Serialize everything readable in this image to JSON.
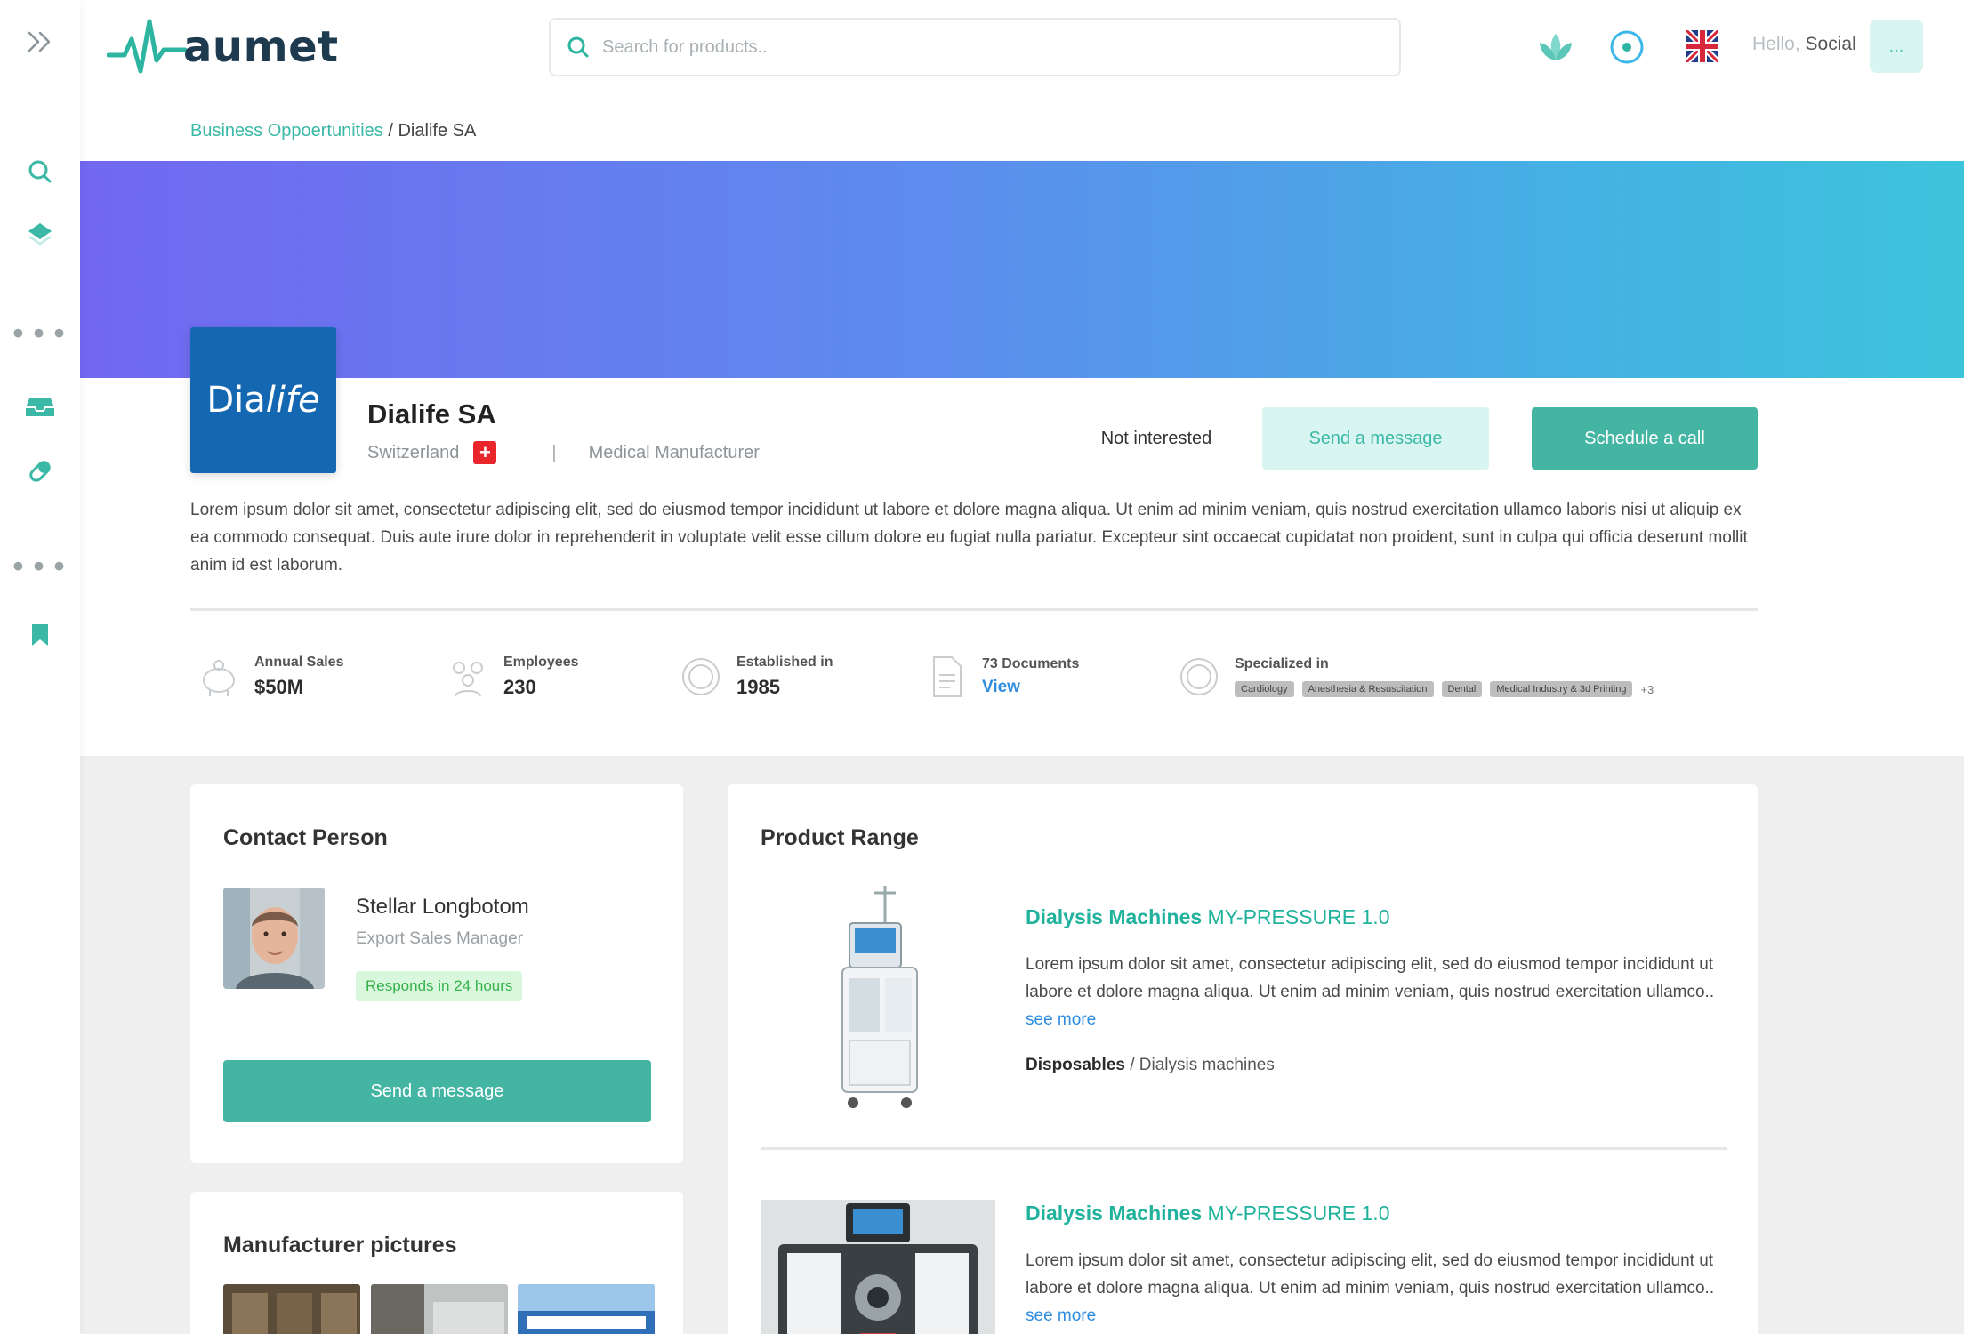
{
  "header": {
    "logo_text": "aumet",
    "search_placeholder": "Search for products..",
    "greeting": "Hello,",
    "user_name": "Social",
    "avatar_label": "..."
  },
  "breadcrumb": {
    "parent": "Business Oppoertunities",
    "separator": "/",
    "current": "Dialife SA"
  },
  "company": {
    "logo_text_1": "Dia",
    "logo_text_2": "life",
    "name": "Dialife SA",
    "country": "Switzerland",
    "type_separator": "|",
    "type": "Medical Manufacturer",
    "description": "Lorem ipsum dolor sit amet, consectetur adipiscing elit, sed do eiusmod tempor incididunt ut labore et dolore magna aliqua. Ut enim ad minim veniam, quis nostrud exercitation ullamco laboris nisi ut aliquip ex ea commodo consequat. Duis aute irure dolor in reprehenderit in voluptate velit esse cillum dolore eu fugiat nulla pariatur. Excepteur sint occaecat cupidatat non proident, sunt in culpa qui officia deserunt mollit anim id est laborum."
  },
  "actions": {
    "not_interested": "Not interested",
    "send_message": "Send a message",
    "schedule_call": "Schedule a call"
  },
  "stats": {
    "annual_sales": {
      "label": "Annual Sales",
      "value": "$50M"
    },
    "employees": {
      "label": "Employees",
      "value": "230"
    },
    "established": {
      "label": "Established in",
      "value": "1985"
    },
    "documents": {
      "label": "73 Documents",
      "value": "View"
    },
    "specialized": {
      "label": "Specialized in",
      "tags": [
        "Cardiology",
        "Anesthesia & Resuscitation",
        "Dental",
        "Medical Industry & 3d Printing"
      ],
      "more": "+3"
    }
  },
  "contact": {
    "title": "Contact Person",
    "name": "Stellar Longbotom",
    "role": "Export Sales Manager",
    "responds": "Responds in 24 hours",
    "button": "Send a message"
  },
  "pictures": {
    "title": "Manufacturer pictures"
  },
  "products": {
    "title": "Product Range",
    "items": [
      {
        "title_bold": "Dialysis Machines",
        "title_rest": "MY-PRESSURE 1.0",
        "desc": "Lorem ipsum dolor sit amet, consectetur adipiscing elit, sed do eiusmod tempor incididunt ut labore et dolore magna aliqua. Ut enim ad minim veniam, quis nostrud exercitation ullamco..",
        "see_more": "see more",
        "category": "Disposables",
        "subcategory": "/ Dialysis machines"
      },
      {
        "title_bold": "Dialysis Machines",
        "title_rest": "MY-PRESSURE 1.0",
        "desc": "Lorem ipsum dolor sit amet, consectetur adipiscing elit, sed do eiusmod tempor incididunt ut labore et dolore magna aliqua. Ut enim ad minim veniam, quis nostrud exercitation ullamco..",
        "see_more": "see more"
      }
    ]
  },
  "colors": {
    "brand_teal": "#45b5a3",
    "brand_teal_light": "#d8f5f1",
    "link_blue": "#2f8de0",
    "banner_start": "#7267f0",
    "banner_end": "#3dc4dc",
    "logo_blue": "#1468b1"
  },
  "icons": {
    "sidebar": [
      "expand-icon",
      "search-icon",
      "layers-icon",
      "more-icon",
      "inbox-icon",
      "pill-icon",
      "more-icon",
      "bookmark-icon"
    ],
    "header": [
      "lotus-icon",
      "target-icon",
      "uk-flag-icon"
    ]
  }
}
